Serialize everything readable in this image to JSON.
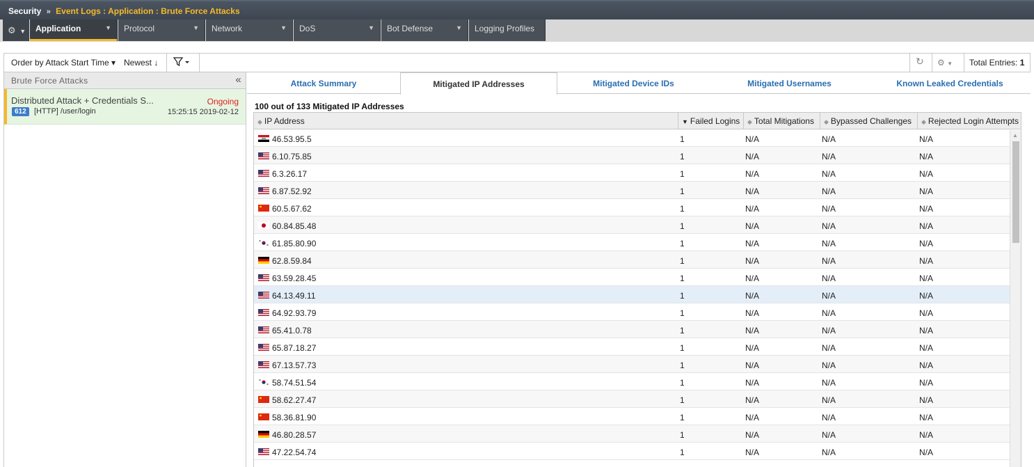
{
  "breadcrumb": {
    "root": "Security",
    "separator": "»",
    "path": "Event Logs : Application : Brute Force Attacks"
  },
  "menu": {
    "gear_icon": "gear-icon",
    "items": [
      {
        "label": "Application",
        "has_caret": true
      },
      {
        "label": "Protocol",
        "has_caret": true
      },
      {
        "label": "Network",
        "has_caret": true
      },
      {
        "label": "DoS",
        "has_caret": true
      },
      {
        "label": "Bot Defense",
        "has_caret": true
      },
      {
        "label": "Logging Profiles",
        "has_caret": false
      }
    ],
    "caret": "▼"
  },
  "toolbar": {
    "order_label": "Order by Attack Start Time ▾",
    "newest_label": "Newest ↓",
    "filter_icon": "filter-icon",
    "refresh_icon": "refresh-icon",
    "settings_icon": "gear-icon",
    "total_label": "Total Entries:",
    "total_value": "1"
  },
  "left_panel": {
    "title": "Brute Force Attacks",
    "collapse": "«",
    "attack": {
      "title": "Distributed Attack + Credentials S...",
      "status": "Ongoing",
      "badge": "612",
      "path": "[HTTP] /user/login",
      "time": "15:25:15 2019-02-12"
    }
  },
  "tabs": [
    {
      "label": "Attack Summary"
    },
    {
      "label": "Mitigated IP Addresses"
    },
    {
      "label": "Mitigated Device IDs"
    },
    {
      "label": "Mitigated Usernames"
    },
    {
      "label": "Known Leaked Credentials"
    }
  ],
  "active_tab": "Mitigated IP Addresses",
  "grid": {
    "count_label": "100 out of 133 Mitigated IP Addresses",
    "columns": [
      "IP Address",
      "Failed Logins",
      "Total Mitigations",
      "Bypassed Challenges",
      "Rejected Login Attempts"
    ],
    "rows": [
      {
        "flag": "iq",
        "ip": "46.53.95.5",
        "failed": "1",
        "total": "N/A",
        "bypassed": "N/A",
        "rejected": "N/A"
      },
      {
        "flag": "us",
        "ip": "6.10.75.85",
        "failed": "1",
        "total": "N/A",
        "bypassed": "N/A",
        "rejected": "N/A"
      },
      {
        "flag": "us",
        "ip": "6.3.26.17",
        "failed": "1",
        "total": "N/A",
        "bypassed": "N/A",
        "rejected": "N/A"
      },
      {
        "flag": "us",
        "ip": "6.87.52.92",
        "failed": "1",
        "total": "N/A",
        "bypassed": "N/A",
        "rejected": "N/A"
      },
      {
        "flag": "cn",
        "ip": "60.5.67.62",
        "failed": "1",
        "total": "N/A",
        "bypassed": "N/A",
        "rejected": "N/A"
      },
      {
        "flag": "jp",
        "ip": "60.84.85.48",
        "failed": "1",
        "total": "N/A",
        "bypassed": "N/A",
        "rejected": "N/A"
      },
      {
        "flag": "kr",
        "ip": "61.85.80.90",
        "failed": "1",
        "total": "N/A",
        "bypassed": "N/A",
        "rejected": "N/A"
      },
      {
        "flag": "de",
        "ip": "62.8.59.84",
        "failed": "1",
        "total": "N/A",
        "bypassed": "N/A",
        "rejected": "N/A"
      },
      {
        "flag": "us",
        "ip": "63.59.28.45",
        "failed": "1",
        "total": "N/A",
        "bypassed": "N/A",
        "rejected": "N/A"
      },
      {
        "flag": "us",
        "ip": "64.13.49.11",
        "failed": "1",
        "total": "N/A",
        "bypassed": "N/A",
        "rejected": "N/A"
      },
      {
        "flag": "us",
        "ip": "64.92.93.79",
        "failed": "1",
        "total": "N/A",
        "bypassed": "N/A",
        "rejected": "N/A"
      },
      {
        "flag": "us",
        "ip": "65.41.0.78",
        "failed": "1",
        "total": "N/A",
        "bypassed": "N/A",
        "rejected": "N/A"
      },
      {
        "flag": "us",
        "ip": "65.87.18.27",
        "failed": "1",
        "total": "N/A",
        "bypassed": "N/A",
        "rejected": "N/A"
      },
      {
        "flag": "us",
        "ip": "67.13.57.73",
        "failed": "1",
        "total": "N/A",
        "bypassed": "N/A",
        "rejected": "N/A"
      },
      {
        "flag": "kr",
        "ip": "58.74.51.54",
        "failed": "1",
        "total": "N/A",
        "bypassed": "N/A",
        "rejected": "N/A"
      },
      {
        "flag": "cn",
        "ip": "58.62.27.47",
        "failed": "1",
        "total": "N/A",
        "bypassed": "N/A",
        "rejected": "N/A"
      },
      {
        "flag": "cn",
        "ip": "58.36.81.90",
        "failed": "1",
        "total": "N/A",
        "bypassed": "N/A",
        "rejected": "N/A"
      },
      {
        "flag": "de",
        "ip": "46.80.28.57",
        "failed": "1",
        "total": "N/A",
        "bypassed": "N/A",
        "rejected": "N/A"
      },
      {
        "flag": "us",
        "ip": "47.22.54.74",
        "failed": "1",
        "total": "N/A",
        "bypassed": "N/A",
        "rejected": "N/A"
      }
    ],
    "highlighted_ip": "64.13.49.11"
  }
}
